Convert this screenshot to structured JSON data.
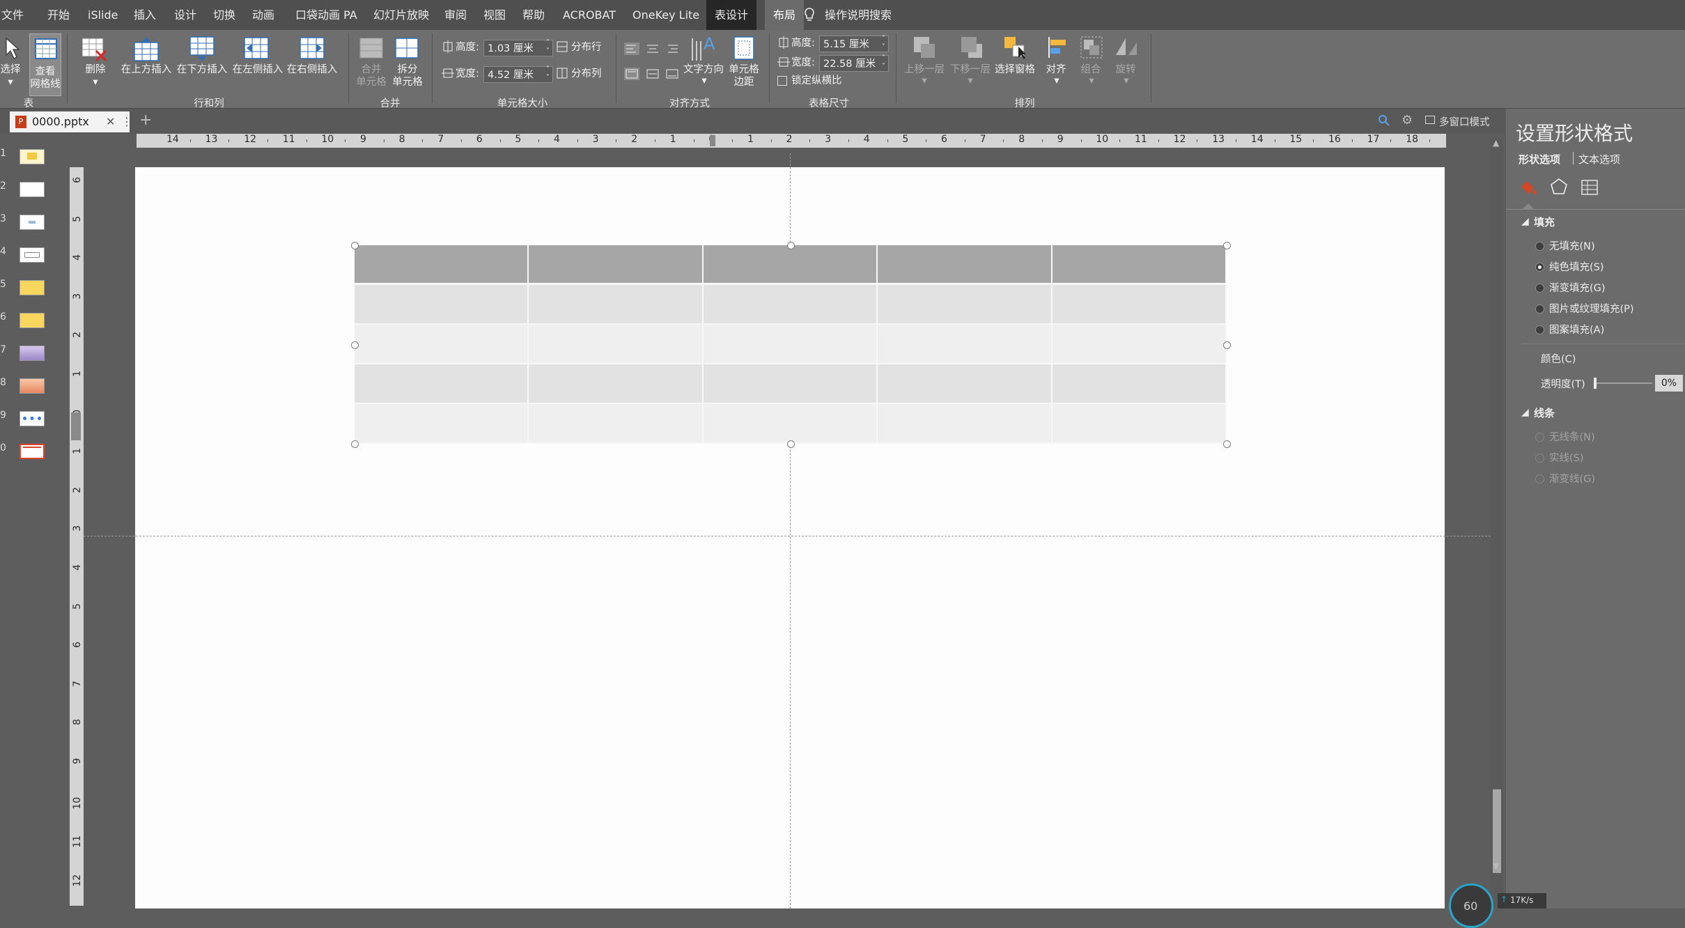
{
  "menu": [
    {
      "label": "文件"
    },
    {
      "label": "开始"
    },
    {
      "label": "iSlide"
    },
    {
      "label": "插入"
    },
    {
      "label": "设计"
    },
    {
      "label": "切换"
    },
    {
      "label": "动画"
    },
    {
      "label": "口袋动画 PA"
    },
    {
      "label": "幻灯片放映"
    },
    {
      "label": "审阅"
    },
    {
      "label": "视图"
    },
    {
      "label": "帮助"
    },
    {
      "label": "ACROBAT"
    },
    {
      "label": "OneKey Lite"
    },
    {
      "label": "表设计"
    },
    {
      "label": "布局"
    },
    {
      "label": "操作说明搜索"
    }
  ],
  "ribbon": {
    "table_group": {
      "select": "选择",
      "gridlines": "查看\n网格线",
      "label": "表"
    },
    "rows_cols": {
      "delete": "删除",
      "insert_above": "在上方插入",
      "insert_below": "在下方插入",
      "insert_left": "在左侧插入",
      "insert_right": "在右侧插入",
      "label": "行和列"
    },
    "merge": {
      "merge_cells": "合并\n单元格",
      "split_cells": "拆分\n单元格",
      "label": "合并"
    },
    "cell_size": {
      "height_label": "高度:",
      "height_value": "1.03 厘米",
      "width_label": "宽度:",
      "width_value": "4.52 厘米",
      "distribute_rows": "分布行",
      "distribute_cols": "分布列",
      "label": "单元格大小"
    },
    "alignment": {
      "text_direction": "文字方向",
      "cell_margins": "单元格\n边距",
      "label": "对齐方式"
    },
    "table_size": {
      "height_label": "高度:",
      "height_value": "5.15 厘米",
      "width_label": "宽度:",
      "width_value": "22.58 厘米",
      "lock_ratio": "锁定纵横比",
      "label": "表格尺寸"
    },
    "arrange": {
      "bring_forward": "上移一层",
      "send_backward": "下移一层",
      "selection_pane": "选择窗格",
      "align": "对齐",
      "group": "组合",
      "rotate": "旋转",
      "label": "排列"
    }
  },
  "tab": {
    "file_name": "0000.pptx",
    "multi_window": "多窗口模式"
  },
  "thumbnails": [
    "1",
    "2",
    "3",
    "4",
    "5",
    "6",
    "7",
    "8",
    "9",
    "0"
  ],
  "ruler_h": [
    "14",
    "13",
    "12",
    "11",
    "10",
    "9",
    "8",
    "7",
    "6",
    "5",
    "4",
    "3",
    "2",
    "1",
    "0",
    "1",
    "2",
    "3",
    "4",
    "5",
    "6",
    "7",
    "8",
    "9",
    "10",
    "11",
    "12",
    "13",
    "14",
    "15",
    "16",
    "17",
    "18"
  ],
  "ruler_v": [
    "6",
    "5",
    "4",
    "3",
    "2",
    "1",
    "0",
    "1",
    "2",
    "3",
    "4",
    "5",
    "6",
    "7",
    "8",
    "9",
    "10",
    "11",
    "12"
  ],
  "pane": {
    "title": "设置形状格式",
    "tab_shape": "形状选项",
    "tab_text": "文本选项",
    "fill_section": "填充",
    "fill_options": [
      "无填充(N)",
      "纯色填充(S)",
      "渐变填充(G)",
      "图片或纹理填充(P)",
      "图案填充(A)"
    ],
    "color_label": "颜色(C)",
    "transparency_label": "透明度(T)",
    "transparency_value": "0%",
    "line_section": "线条",
    "line_options": [
      "无线条(N)",
      "实线(S)",
      "渐变线(G)"
    ]
  },
  "status": {
    "net_speed": "17K/s",
    "gauge": "60"
  },
  "colors": {
    "header_fill": "#a6a6a6",
    "row_dark": "#e2e2e2",
    "row_light": "#efefef",
    "fill_icon": "#d24726"
  }
}
